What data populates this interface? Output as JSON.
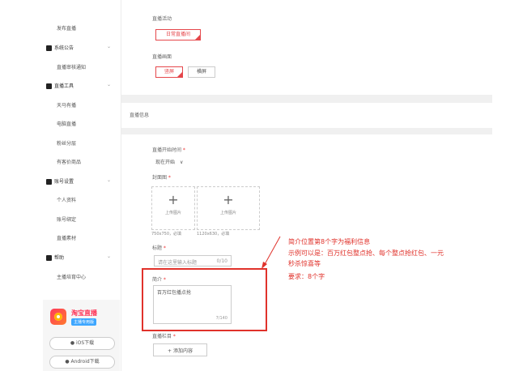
{
  "sidebar": {
    "items": [
      {
        "label": "发布直播"
      },
      {
        "label": "系统公告"
      },
      {
        "label": "直播审核通知"
      },
      {
        "label": "直播工具"
      },
      {
        "label": "天马有播"
      },
      {
        "label": "电脑直播"
      },
      {
        "label": "粉丝分层"
      },
      {
        "label": "有客价商品"
      },
      {
        "label": "账号设置"
      },
      {
        "label": "个人资料"
      },
      {
        "label": "账号绑定"
      },
      {
        "label": "直播素材"
      },
      {
        "label": "帮助"
      },
      {
        "label": "主播培育中心"
      }
    ],
    "app": {
      "title": "淘宝直播",
      "subtitle": "主播专用版",
      "ios": "iOS下载",
      "android": "Android下载"
    }
  },
  "form": {
    "activity_label": "直播活动",
    "activity_value": "日常直播间",
    "screen_label": "直播画面",
    "screen_vertical": "竖屏",
    "screen_horizontal": "横屏",
    "info_section": "直播信息",
    "start_label": "直播开始时间",
    "start_value": "现在开始",
    "cover_label": "封面图",
    "upload_caption": "上传图片",
    "upload_size1": "750x750，必填",
    "upload_size2": "1120x630，必填",
    "title_label": "标题",
    "title_placeholder": "请在这里输入标题",
    "title_counter": "0/10",
    "intro_label": "简介",
    "intro_value": "百万红包播点抢",
    "intro_counter": "7/140",
    "channel_label": "直播栏目",
    "channel_button": "添加内容"
  },
  "annotation": {
    "line1": "简介位置第8个字为福利信息",
    "line2": "示例可以是：百万红包整点抢、每个整点抢红包、一元",
    "line3": "秒杀惊喜等",
    "line4": "要求：8个字"
  },
  "colors": {
    "accent": "#e5474b",
    "annotation": "#e0322b"
  }
}
